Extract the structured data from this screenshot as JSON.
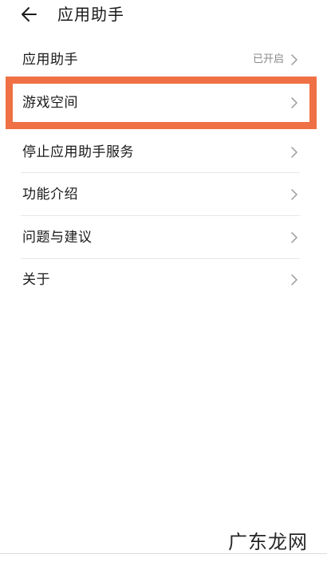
{
  "header": {
    "back_icon": "arrow-left-icon",
    "title": "应用助手"
  },
  "rows": [
    {
      "label": "应用助手",
      "status": "已开启",
      "icon": "chevron-right-icon"
    },
    {
      "label": "游戏空间",
      "icon": "chevron-right-icon",
      "highlighted": true
    },
    {
      "label": "停止应用助手服务",
      "icon": "chevron-right-icon"
    },
    {
      "label": "功能介绍",
      "icon": "chevron-right-icon"
    },
    {
      "label": "问题与建议",
      "icon": "chevron-right-icon"
    },
    {
      "label": "关于",
      "icon": "chevron-right-icon"
    }
  ],
  "highlight_color": "#f07045",
  "watermark": "广东龙网"
}
